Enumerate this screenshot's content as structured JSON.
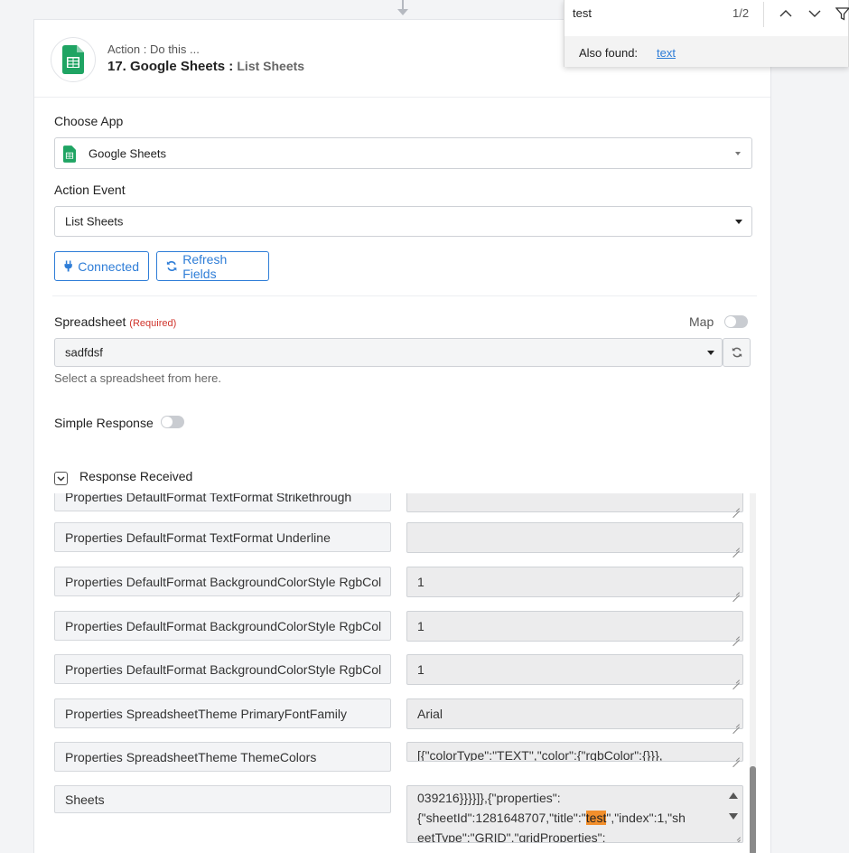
{
  "header": {
    "kicker": "Action : Do this ...",
    "title": "17. Google Sheets : ",
    "subtitle": "List Sheets"
  },
  "choose_app": {
    "label": "Choose App",
    "value": "Google Sheets"
  },
  "action_event": {
    "label": "Action Event",
    "value": "List Sheets"
  },
  "buttons": {
    "connected": "Connected",
    "refresh": "Refresh Fields"
  },
  "spreadsheet": {
    "label": "Spreadsheet",
    "required": "(Required)",
    "map_label": "Map",
    "value": "sadfdsf",
    "hint": "Select a spreadsheet from here."
  },
  "simple_response": {
    "label": "Simple Response"
  },
  "response": {
    "title": "Response Received",
    "rows": [
      {
        "key": "Properties DefaultFormat TextFormat Strikethrough",
        "value": ""
      },
      {
        "key": "Properties DefaultFormat TextFormat Underline",
        "value": ""
      },
      {
        "key": "Properties DefaultFormat BackgroundColorStyle RgbCol",
        "value": "1"
      },
      {
        "key": "Properties DefaultFormat BackgroundColorStyle RgbCol",
        "value": "1"
      },
      {
        "key": "Properties DefaultFormat BackgroundColorStyle RgbCol",
        "value": "1"
      },
      {
        "key": "Properties SpreadsheetTheme PrimaryFontFamily",
        "value": "Arial"
      },
      {
        "key": "Properties SpreadsheetTheme ThemeColors",
        "value": "[{\"colorType\":\"TEXT\",\"color\":{\"rgbColor\":{}}},"
      }
    ],
    "sheets": {
      "key": "Sheets",
      "line1": "039216}}}}]},{\"properties\":",
      "line2_pre": "{\"sheetId\":1281648707,\"title\":\"",
      "line2_hl": "test",
      "line2_post": "\",\"index\":1,\"sh",
      "line3": "eetType\":\"GRID\",\"gridProperties\":"
    }
  },
  "find_bar": {
    "query": "test",
    "count": "1/2",
    "also_found_label": "Also found:",
    "also_found_link": "text"
  },
  "colors": {
    "accent": "#2e7dd7",
    "sheets_green": "#1fa463",
    "highlight": "#f28f2c",
    "required": "#d0342c"
  }
}
